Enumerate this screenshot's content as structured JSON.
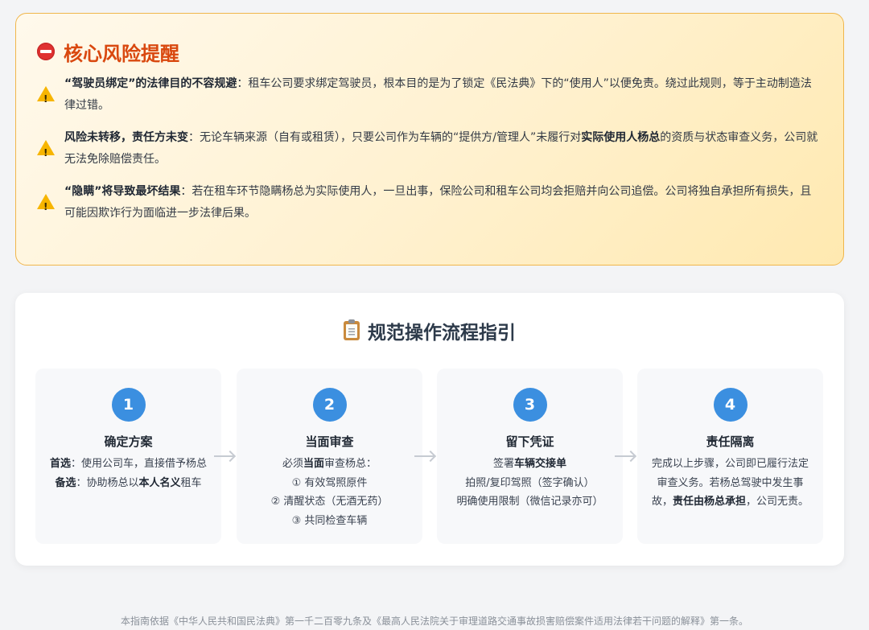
{
  "risk": {
    "title": "核心风险提醒",
    "items": [
      {
        "bold": "“驾驶员绑定”的法律目的不容规避",
        "text": "：租车公司要求绑定驾驶员，根本目的是为了锁定《民法典》下的“使用人”以便免责。绕过此规则，等于主动制造法律过错。"
      },
      {
        "bold": "风险未转移，责任方未变",
        "text_a": "：无论车辆来源（自有或租赁），只要公司作为车辆的“提供方/管理人”未履行对",
        "bold_b": "实际使用人杨总",
        "text_b": "的资质与状态审查义务，公司就无法免除赔偿责任。"
      },
      {
        "bold": "“隐瞒”将导致最坏结果",
        "text": "：若在租车环节隐瞒杨总为实际使用人，一旦出事，保险公司和租车公司均会拒赔并向公司追偿。公司将独自承担所有损失，且可能因欺诈行为面临进一步法律后果。"
      }
    ]
  },
  "flow": {
    "title": "规范操作流程指引",
    "steps": [
      {
        "num": "1",
        "title": "确定方案",
        "l1_bold": "首选",
        "l1": "：使用公司车，直接借予杨总",
        "l2_bold": "备选",
        "l2_a": "：协助杨总以",
        "l2_bold_b": "本人名义",
        "l2_b": "租车"
      },
      {
        "num": "2",
        "title": "当面审查",
        "l1_a": "必须",
        "l1_bold": "当面",
        "l1_b": "审查杨总：",
        "l2": "① 有效驾照原件",
        "l3": "② 清醒状态（无酒无药）",
        "l4": "③ 共同检查车辆"
      },
      {
        "num": "3",
        "title": "留下凭证",
        "l1_a": "签署",
        "l1_bold": "车辆交接单",
        "l2": "拍照/复印驾照（签字确认）",
        "l3": "明确使用限制（微信记录亦可）"
      },
      {
        "num": "4",
        "title": "责任隔离",
        "l1": "完成以上步骤，公司即已履行法定",
        "l2": "审查义务。若杨总驾驶中发生事",
        "l3_a": "故，",
        "l3_bold": "责任由杨总承担",
        "l3_b": "，公司无责。"
      }
    ]
  },
  "footer": {
    "note": "本指南依据《中华人民共和国民法典》第一千二百零九条及《最高人民法院关于审理道路交通事故损害赔偿案件适用法律若干问题的解释》第一条。"
  },
  "colors": {
    "accent": "#3b8fe0",
    "risk_title": "#d9480f",
    "risk_border": "#f0b64b",
    "warning": "#f7b500"
  },
  "icons": [
    "stop-icon",
    "warning-icon",
    "clipboard-icon",
    "arrow-right-icon"
  ]
}
